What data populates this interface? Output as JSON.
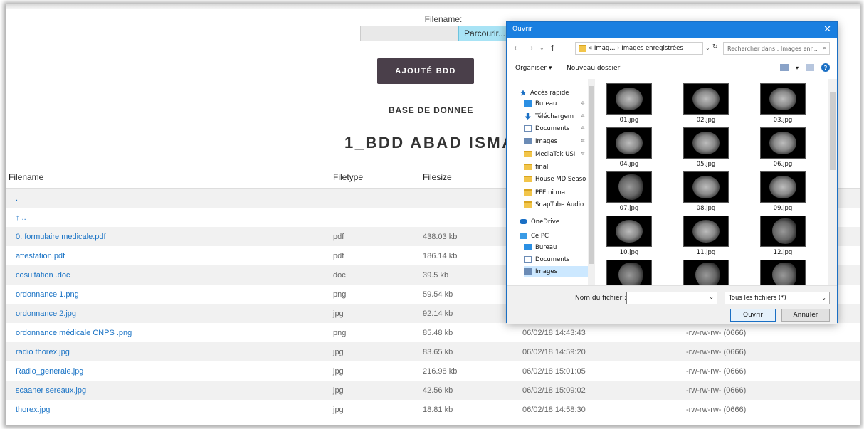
{
  "page": {
    "filename_label": "Filename:",
    "browse_label": "Parcourir...",
    "add_button": "AJOUTÉ BDD",
    "base_label": "BASE DE DONNEE",
    "db_title": "1_BDD ABAD ISMA"
  },
  "table": {
    "headers": [
      "Filename",
      "Filetype",
      "Filesize",
      "",
      ""
    ],
    "rows": [
      {
        "name": ".",
        "type": "",
        "size": "",
        "date": "",
        "perms": ""
      },
      {
        "name": "↑ ..",
        "type": "",
        "size": "",
        "date": "",
        "perms": ""
      },
      {
        "name": "0. formulaire medicale.pdf",
        "type": "pdf",
        "size": "438.03 kb",
        "date": "",
        "perms": ""
      },
      {
        "name": "attestation.pdf",
        "type": "pdf",
        "size": "186.14 kb",
        "date": "",
        "perms": ""
      },
      {
        "name": "cosultation .doc",
        "type": "doc",
        "size": "39.5 kb",
        "date": "",
        "perms": ""
      },
      {
        "name": "ordonnance 1.png",
        "type": "png",
        "size": "59.54 kb",
        "date": "",
        "perms": ""
      },
      {
        "name": "ordonnance 2.jpg",
        "type": "jpg",
        "size": "92.14 kb",
        "date": "",
        "perms": ""
      },
      {
        "name": "ordonnance médicale CNPS .png",
        "type": "png",
        "size": "85.48 kb",
        "date": "06/02/18 14:43:43",
        "perms": "-rw-rw-rw- (0666)"
      },
      {
        "name": "radio thorex.jpg",
        "type": "jpg",
        "size": "83.65 kb",
        "date": "06/02/18 14:59:20",
        "perms": "-rw-rw-rw- (0666)"
      },
      {
        "name": "Radio_generale.jpg",
        "type": "jpg",
        "size": "216.98 kb",
        "date": "06/02/18 15:01:05",
        "perms": "-rw-rw-rw- (0666)"
      },
      {
        "name": "scaaner sereaux.jpg",
        "type": "jpg",
        "size": "42.56 kb",
        "date": "06/02/18 15:09:02",
        "perms": "-rw-rw-rw- (0666)"
      },
      {
        "name": "thorex.jpg",
        "type": "jpg",
        "size": "18.81 kb",
        "date": "06/02/18 14:58:30",
        "perms": "-rw-rw-rw- (0666)"
      }
    ]
  },
  "dialog": {
    "title": "Ouvrir",
    "close": "✕",
    "address": "« Imag... › Images enregistrées",
    "search_placeholder": "Rechercher dans : Images enr...",
    "organize": "Organiser ▾",
    "new_folder": "Nouveau dossier",
    "tree": [
      {
        "label": "Accès rapide",
        "icon": "star-icon",
        "pinned": false
      },
      {
        "label": "Bureau",
        "icon": "desktop-icon",
        "pinned": true
      },
      {
        "label": "Téléchargem",
        "icon": "download-icon",
        "pinned": true
      },
      {
        "label": "Documents",
        "icon": "document-icon",
        "pinned": true
      },
      {
        "label": "Images",
        "icon": "images-icon",
        "pinned": true
      },
      {
        "label": "MediaTek USI",
        "icon": "folder-icon",
        "pinned": true
      },
      {
        "label": "final",
        "icon": "folder-icon",
        "pinned": false
      },
      {
        "label": "House MD Seaso",
        "icon": "folder-icon",
        "pinned": false
      },
      {
        "label": "PFE ni ma",
        "icon": "folder-icon",
        "pinned": false
      },
      {
        "label": "SnapTube Audio",
        "icon": "folder-icon",
        "pinned": false
      },
      {
        "label": "OneDrive",
        "icon": "cloud-icon",
        "pinned": false
      },
      {
        "label": "Ce PC",
        "icon": "computer-icon",
        "pinned": false
      },
      {
        "label": "Bureau",
        "icon": "desktop-icon",
        "pinned": false
      },
      {
        "label": "Documents",
        "icon": "document-icon",
        "pinned": false
      },
      {
        "label": "Images",
        "icon": "images-icon",
        "pinned": false
      }
    ],
    "files": [
      "01.jpg",
      "02.jpg",
      "03.jpg",
      "04.jpg",
      "05.jpg",
      "06.jpg",
      "07.jpg",
      "08.jpg",
      "09.jpg",
      "10.jpg",
      "11.jpg",
      "12.jpg",
      "",
      "",
      ""
    ],
    "filename_label": "Nom du fichier :",
    "filetype": "Tous les fichiers (*)",
    "open_button": "Ouvrir",
    "cancel_button": "Annuler"
  },
  "colors": {
    "link": "#1a73c5",
    "accent": "#1a7fe0",
    "button_dark": "#4a3f4a",
    "browse_bg": "#a8e3f5"
  }
}
